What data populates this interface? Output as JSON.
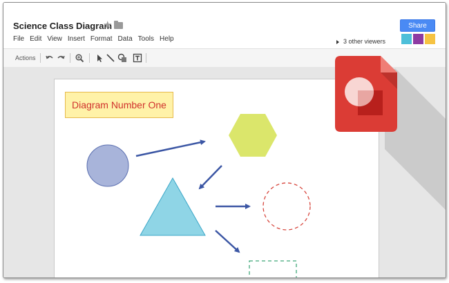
{
  "header": {
    "title": "Science Class Diagram",
    "menu": [
      "File",
      "Edit",
      "View",
      "Insert",
      "Format",
      "Data",
      "Tools",
      "Help"
    ],
    "viewers": "3 other viewers",
    "share_label": "Share",
    "avatars": [
      "#4dbfd9",
      "#8e3ba3",
      "#f6c343"
    ]
  },
  "toolbar": {
    "actions_label": "Actions",
    "icons": [
      "undo-icon",
      "redo-icon",
      "zoom-icon",
      "select-icon",
      "line-icon",
      "shape-icon",
      "textbox-icon"
    ]
  },
  "canvas": {
    "title_box": "Diagram Number One",
    "shapes": [
      {
        "name": "circle",
        "fill": "#a8b4da",
        "stroke": "#5b6fb0"
      },
      {
        "name": "hexagon",
        "fill": "#dbe66b"
      },
      {
        "name": "triangle",
        "fill": "#8fd5e6",
        "stroke": "#3aa6c7"
      },
      {
        "name": "dashed-circle",
        "stroke": "#d7463d"
      },
      {
        "name": "dashed-rectangle",
        "stroke": "#3fa878"
      }
    ],
    "arrow_color": "#3b56a4"
  },
  "app_icon": {
    "name": "google-drawings-icon",
    "color": "#db3c35"
  }
}
